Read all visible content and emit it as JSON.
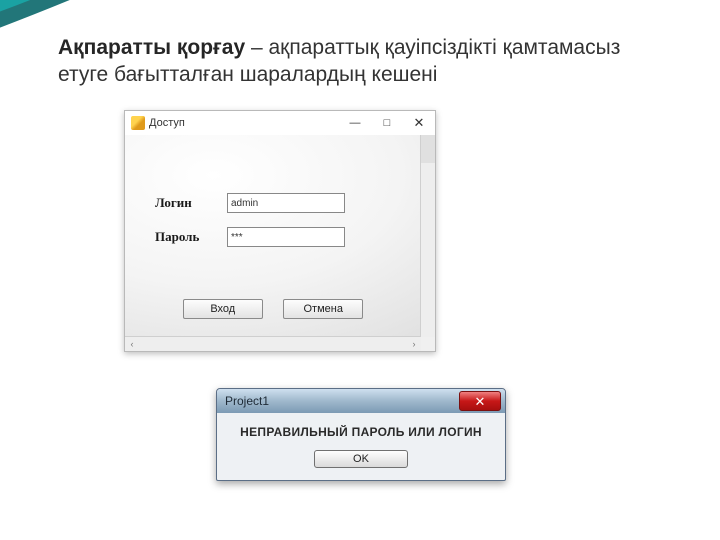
{
  "slide": {
    "heading_bold": "Ақпаратты қорғау",
    "heading_rest": " – ақпараттық қауіпсіздікті қамтамасыз етуге бағытталған шаралардың кешені"
  },
  "login_window": {
    "title": "Доступ",
    "caption_buttons": {
      "minimize": "—",
      "maximize": "□",
      "close": "✕"
    },
    "login_label": "Логин",
    "login_value": "admin",
    "password_label": "Пароль",
    "password_value": "***",
    "submit_label": "Вход",
    "cancel_label": "Отмена",
    "hscroll_left": "‹",
    "hscroll_right": "›"
  },
  "msg_window": {
    "title": "Project1",
    "close_glyph": "✕",
    "message": "НЕПРАВИЛЬНЫЙ ПАРОЛЬ ИЛИ ЛОГИН",
    "ok_label": "OK"
  }
}
